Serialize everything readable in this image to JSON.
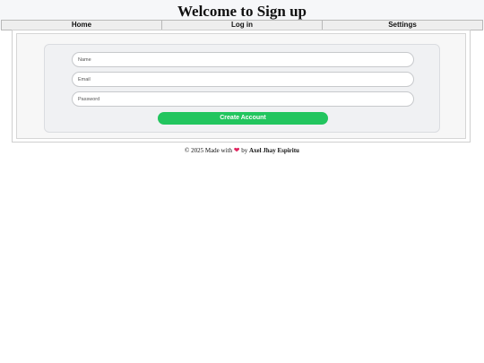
{
  "header": {
    "title": "Welcome to Sign up"
  },
  "nav": {
    "items": [
      "Home",
      "Log in",
      "Settings"
    ]
  },
  "form": {
    "name_placeholder": "Name",
    "email_placeholder": "Email",
    "password_placeholder": "Password",
    "submit_label": "Create Account"
  },
  "footer": {
    "prefix": "© 2025 Made with",
    "heart": "❤",
    "by": "by",
    "author": "Axel Jhay Espiritu"
  },
  "colors": {
    "accent": "#22c55e",
    "heart": "#e0245e"
  }
}
